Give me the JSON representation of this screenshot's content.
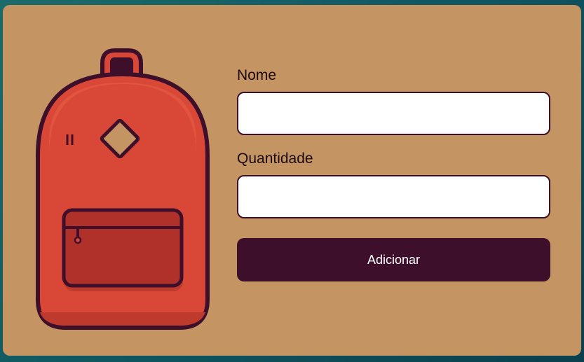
{
  "form": {
    "name_label": "Nome",
    "name_value": "",
    "quantity_label": "Quantidade",
    "quantity_value": "",
    "submit_label": "Adicionar"
  },
  "colors": {
    "background": "#0f5660",
    "card": "#c49462",
    "accent": "#3e0f2b",
    "backpack": "#d94836"
  },
  "icons": {
    "illustration": "backpack-illustration"
  }
}
